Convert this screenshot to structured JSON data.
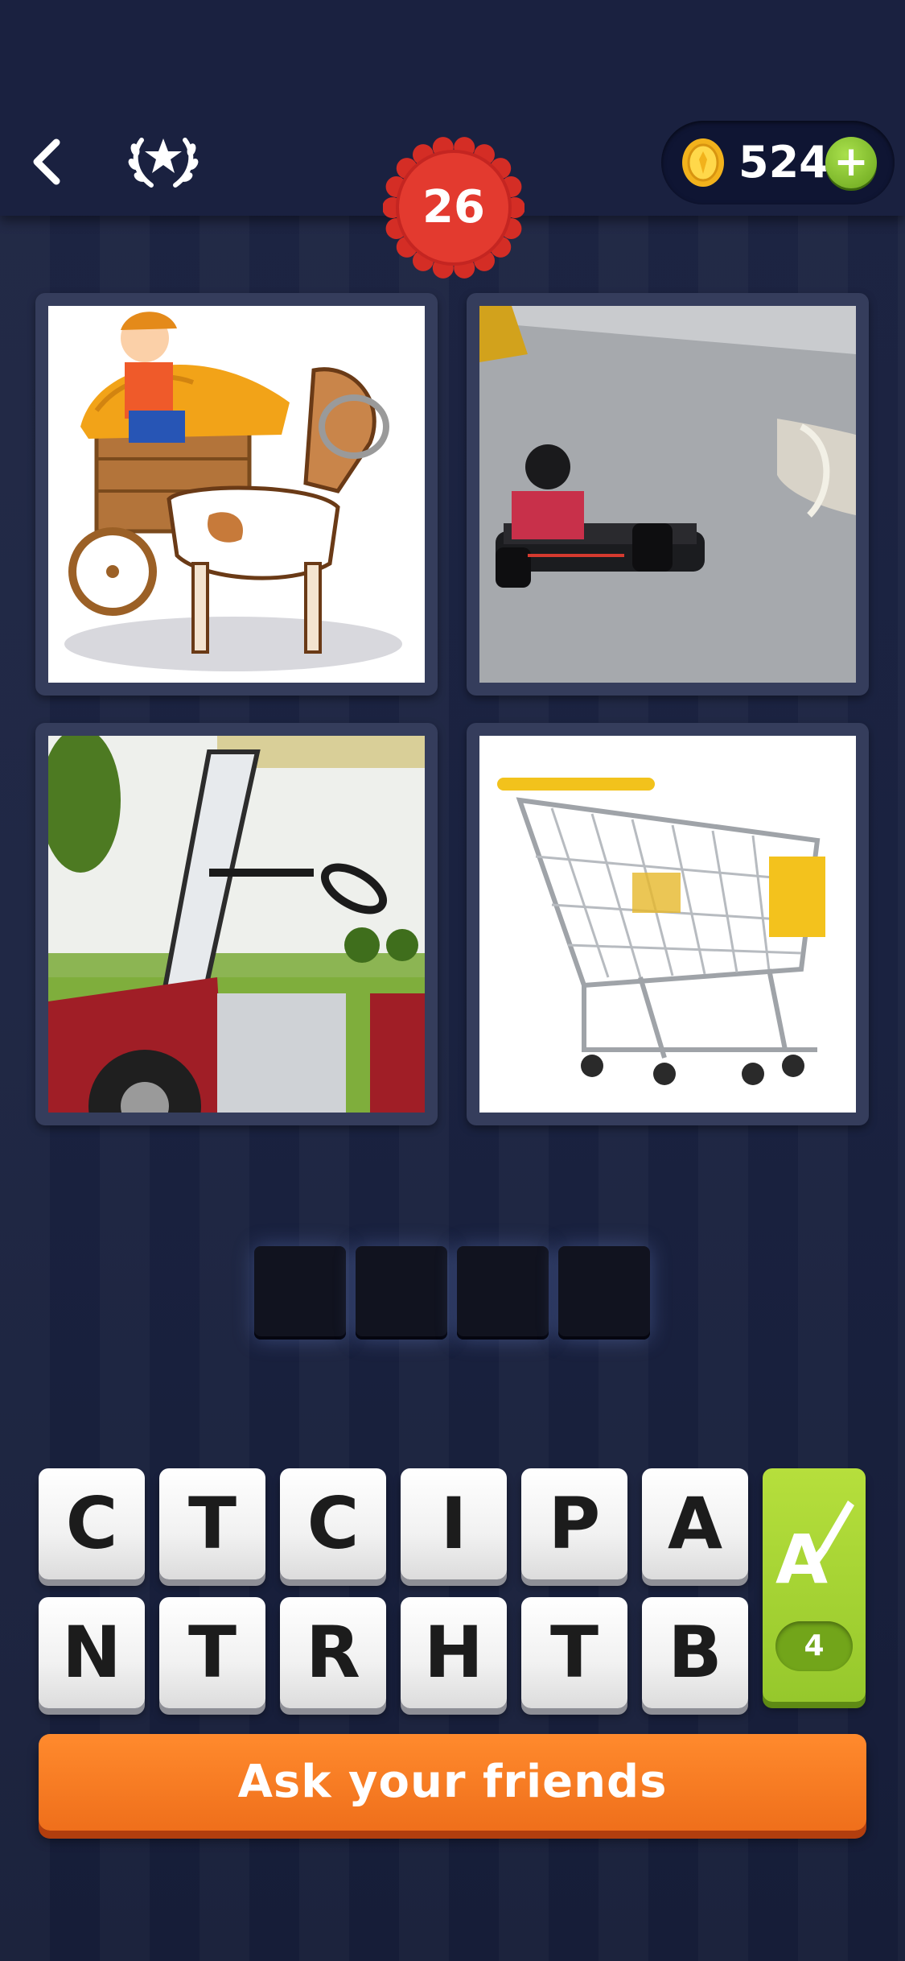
{
  "header": {
    "back_icon": "chevron-left-icon",
    "rank_icon": "laurel-star-icon",
    "level": "26",
    "coins": "524",
    "coin_icon": "gold-coin-icon",
    "add_coins_label": "+"
  },
  "puzzle": {
    "images": [
      {
        "subject": "horse-drawn-cart"
      },
      {
        "subject": "go-kart"
      },
      {
        "subject": "golf-cart"
      },
      {
        "subject": "shopping-cart"
      }
    ],
    "answer_slots": [
      "",
      "",
      "",
      ""
    ]
  },
  "keyboard": {
    "row1": [
      "C",
      "T",
      "C",
      "I",
      "P",
      "A"
    ],
    "row2": [
      "N",
      "T",
      "R",
      "H",
      "T",
      "B"
    ],
    "hint": {
      "icon": "paint-brush-letter-icon",
      "count": "4"
    }
  },
  "ask_button": {
    "label": "Ask your friends"
  },
  "colors": {
    "background": "#1d2442",
    "badge_red": "#e0302b",
    "hint_green": "#9ccd2f",
    "ask_orange": "#f57a22"
  }
}
